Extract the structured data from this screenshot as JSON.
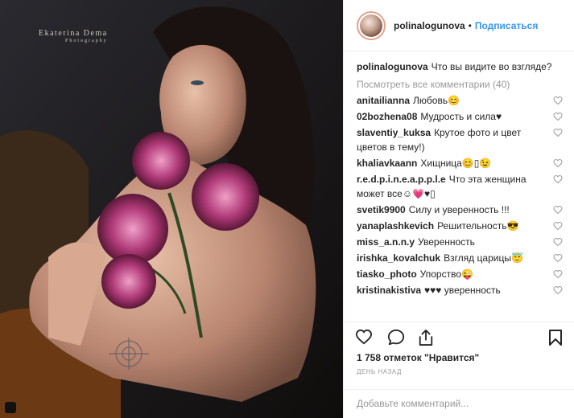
{
  "photo": {
    "watermark_name": "Ekaterina Dema",
    "watermark_sub": "Photography"
  },
  "header": {
    "username": "polinalogunova",
    "separator": "•",
    "follow_label": "Подписаться"
  },
  "caption": {
    "username": "polinalogunova",
    "text": "Что вы видите во взгляде?"
  },
  "view_all_label": "Посмотреть все комментарии (40)",
  "comments": [
    {
      "user": "anitailianna",
      "text": "Любовь😊"
    },
    {
      "user": "02bozhena08",
      "text": "Мудрость и сила♥"
    },
    {
      "user": "slaventiy_kuksa",
      "text": "Крутое фото и цвет цветов в тему!)"
    },
    {
      "user": "khaliavkaann",
      "text": "Хищница😊▯😉"
    },
    {
      "user": "r.e.d.p.i.n.e.a.p.p.l.e",
      "text": "Что эта женщина может все☺💗♥▯"
    },
    {
      "user": "svetik9900",
      "text": "Силу и уверенность !!!"
    },
    {
      "user": "yanaplashkevich",
      "text": "Решительность😎"
    },
    {
      "user": "miss_a.n.n.y",
      "text": "Уверенность"
    },
    {
      "user": "irishka_kovalchuk",
      "text": "Взгляд царицы😇"
    },
    {
      "user": "tiasko_photo",
      "text": "Упорство😜"
    },
    {
      "user": "kristinakistiva",
      "text": "♥♥♥ уверенность"
    }
  ],
  "likes_text": "1 758 отметок \"Нравится\"",
  "timestamp": "День назад",
  "add_comment": {
    "placeholder": "Добавьте комментарий..."
  },
  "icons": {
    "like": "heart-outline-icon",
    "comment": "speech-bubble-icon",
    "share": "share-upload-icon",
    "save": "bookmark-icon"
  }
}
